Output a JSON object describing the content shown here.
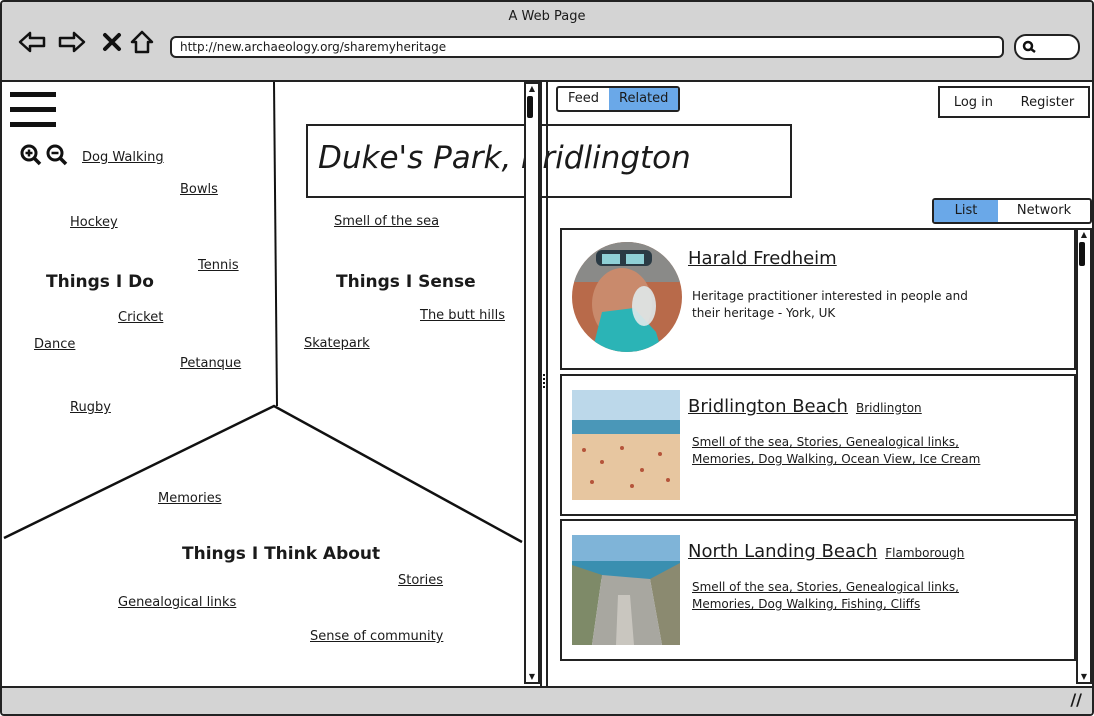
{
  "window": {
    "title": "A Web Page"
  },
  "browser": {
    "url": "http://new.archaeology.org/sharemyheritage"
  },
  "place": {
    "title": "Duke's Park, Bridlington"
  },
  "sections": {
    "do": "Things I Do",
    "sense": "Things I Sense",
    "think": "Things I Think About"
  },
  "do_tags": [
    "Dog Walking",
    "Bowls",
    "Hockey",
    "Tennis",
    "Cricket",
    "Dance",
    "Petanque",
    "Rugby"
  ],
  "sense_tags": [
    "Smell of the sea",
    "The butt hills",
    "Skatepark"
  ],
  "think_tags": [
    "Memories",
    "Stories",
    "Genealogical links",
    "Sense of community"
  ],
  "tabs": {
    "feed": "Feed",
    "related": "Related"
  },
  "auth": {
    "login": "Log in",
    "register": "Register"
  },
  "view": {
    "list": "List",
    "network": "Network"
  },
  "cards": [
    {
      "name": "Harald Fredheim",
      "location": "",
      "text": "Heritage practitioner interested in people and their heritage - York, UK"
    },
    {
      "name": "Bridlington Beach",
      "location": "Bridlington",
      "text": "Smell of the sea, Stories, Genealogical links, Memories, Dog Walking, Ocean View, Ice Cream"
    },
    {
      "name": "North Landing Beach",
      "location": "Flamborough",
      "text": "Smell of the sea, Stories, Genealogical links, Memories, Dog Walking, Fishing, Cliffs"
    }
  ],
  "colors": {
    "accent": "#6aa8e8",
    "chrome": "#d4d4d4"
  }
}
